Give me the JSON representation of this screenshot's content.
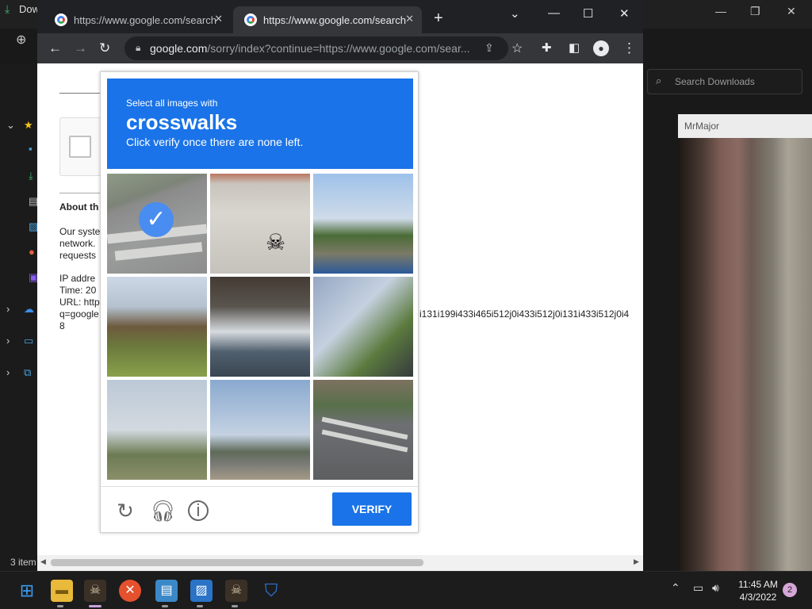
{
  "explorer": {
    "title": "Dow",
    "search_placeholder": "Search Downloads",
    "status": "3 item"
  },
  "side_window": {
    "title": "MrMajor"
  },
  "browser": {
    "tabs": [
      {
        "title": "https://www.google.com/search?"
      },
      {
        "title": "https://www.google.com/search?"
      }
    ],
    "url_domain": "google.com",
    "url_path": "/sorry/index?continue=https://www.google.com/sear..."
  },
  "page": {
    "about_heading": "About th",
    "body_lines": [
      "Our syste",
      "network.",
      "requests"
    ],
    "ip_line": "IP addre",
    "time_line": "Time: 20",
    "url_line": "URL: http",
    "q_line": "q=google",
    "num_line": "8",
    "url_tail": "i131i199i433i465i512j0i433i512j0i131i433i512j0i4"
  },
  "captcha": {
    "line1": "Select all images with",
    "keyword": "crosswalks",
    "line3": "Click verify once there are none left.",
    "verify_label": "VERIFY",
    "tiles": [
      {
        "selected": true
      },
      {
        "selected": false
      },
      {
        "selected": false
      },
      {
        "selected": false
      },
      {
        "selected": false
      },
      {
        "selected": false
      },
      {
        "selected": false
      },
      {
        "selected": false
      },
      {
        "selected": false
      }
    ]
  },
  "taskbar": {
    "time": "11:45 AM",
    "date": "4/3/2022",
    "notifications": "2"
  },
  "colors": {
    "accent": "#1a73e8",
    "chrome_dark": "#202124"
  }
}
